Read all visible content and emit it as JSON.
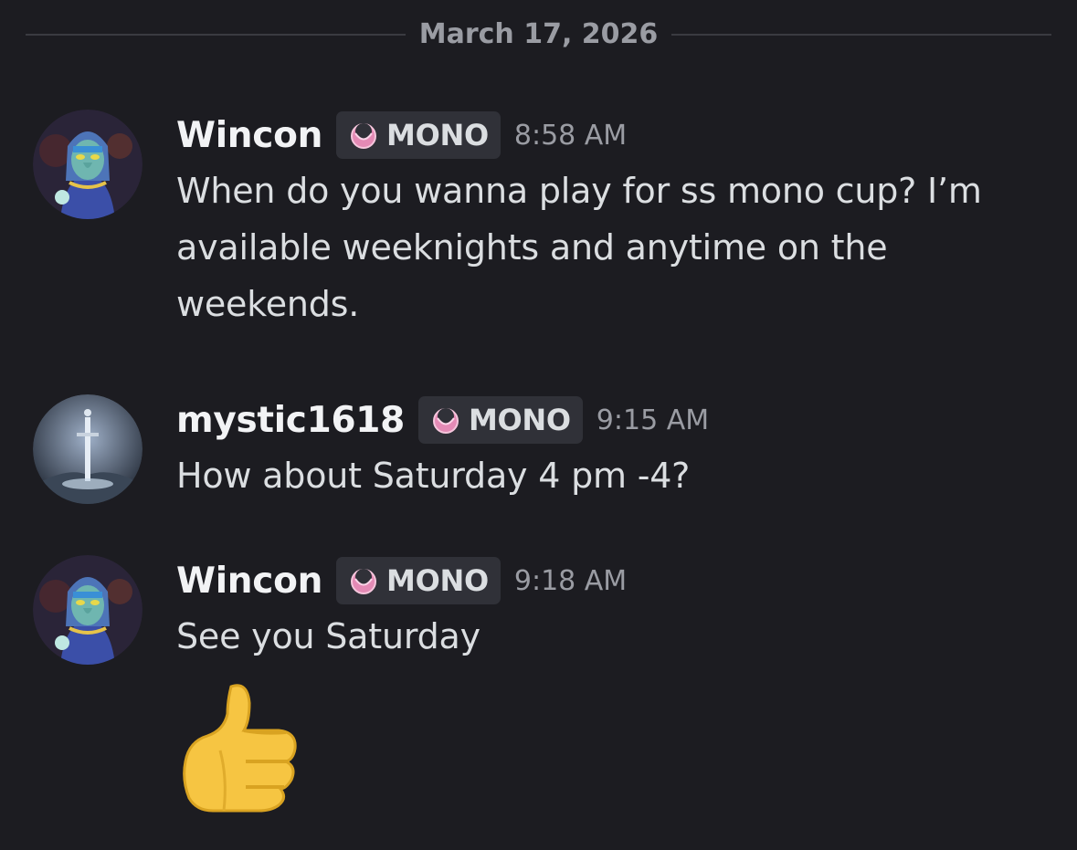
{
  "date_divider": "March 17, 2026",
  "messages": [
    {
      "author": "Wincon",
      "tag": "MONO",
      "time": "8:58 AM",
      "lines": [
        "When do you wanna play for ss mono cup? I’m",
        "available weeknights and anytime on the",
        "weekends."
      ]
    },
    {
      "author": "mystic1618",
      "tag": "MONO",
      "time": "9:15 AM",
      "lines": [
        "How about Saturday 4 pm -4?"
      ]
    },
    {
      "author": "Wincon",
      "tag": "MONO",
      "time": "9:18 AM",
      "lines": [
        "See you Saturday"
      ],
      "emoji": "thumbs-up-emoji"
    }
  ],
  "colors": {
    "background": "#1c1c21",
    "tag_background": "#303138",
    "tag_icon": "#e48ab5"
  }
}
